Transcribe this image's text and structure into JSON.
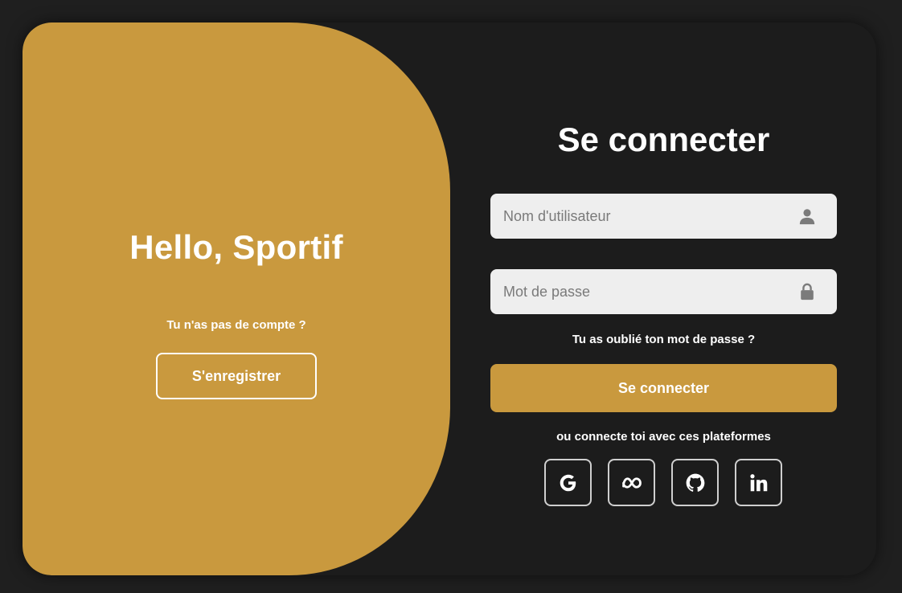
{
  "left": {
    "title": "Hello, Sportif",
    "subtitle": "Tu n'as pas de compte ?",
    "register_label": "S'enregistrer"
  },
  "login": {
    "title": "Se connecter",
    "username_placeholder": "Nom d'utilisateur",
    "password_placeholder": "Mot de passe",
    "forgot_label": "Tu as oublié ton mot de passe ?",
    "submit_label": "Se connecter",
    "platforms_text": "ou connecte toi avec ces plateformes"
  },
  "social": [
    {
      "name": "google",
      "icon": "google-icon"
    },
    {
      "name": "meta",
      "icon": "meta-icon"
    },
    {
      "name": "github",
      "icon": "github-icon"
    },
    {
      "name": "linkedin",
      "icon": "linkedin-icon"
    }
  ],
  "colors": {
    "accent": "#c9993e",
    "background": "#1c1c1c",
    "input_bg": "#eeeeee",
    "text": "#ffffff"
  }
}
